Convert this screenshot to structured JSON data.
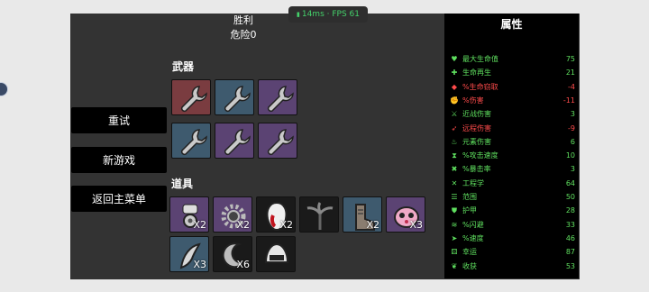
{
  "fps": {
    "text": "14ms · FPS 61"
  },
  "header": {
    "title": "胜利",
    "danger": "危险0"
  },
  "sections": {
    "weapons": "武器",
    "items": "道具"
  },
  "menu": {
    "retry": "重试",
    "new_game": "新游戏",
    "main_menu": "返回主菜单"
  },
  "weapons": [
    {
      "icon": "wrench-icon",
      "tier": "red"
    },
    {
      "icon": "wrench-icon",
      "tier": "blue"
    },
    {
      "icon": "wrench-icon",
      "tier": "purple"
    },
    {
      "icon": "wrench-icon",
      "tier": "blue"
    },
    {
      "icon": "wrench-icon",
      "tier": "purple"
    },
    {
      "icon": "wrench-icon",
      "tier": "purple"
    }
  ],
  "items": [
    {
      "icon": "robot-claw-icon",
      "tier": "purple",
      "qty": "X2"
    },
    {
      "icon": "gear-icon",
      "tier": "purple",
      "qty": "X2"
    },
    {
      "icon": "bloody-tooth-icon",
      "tier": "black",
      "qty": "X2"
    },
    {
      "icon": "tree-icon",
      "tier": "black",
      "qty": ""
    },
    {
      "icon": "boot-icon",
      "tier": "blue",
      "qty": "X2"
    },
    {
      "icon": "pink-blob-icon",
      "tier": "purple",
      "qty": "X3"
    },
    {
      "icon": "horn-icon",
      "tier": "blue",
      "qty": "X3"
    },
    {
      "icon": "moon-icon",
      "tier": "black",
      "qty": "X6"
    },
    {
      "icon": "helmet-icon",
      "tier": "black",
      "qty": ""
    }
  ],
  "stats": {
    "title": "属性",
    "rows": [
      {
        "icon": "heart-icon",
        "label": "最大生命值",
        "value": "75",
        "color": "#5fe05f",
        "glyph": "♥"
      },
      {
        "icon": "regen-icon",
        "label": "生命再生",
        "value": "21",
        "color": "#5fe05f",
        "glyph": "✚"
      },
      {
        "icon": "steal-icon",
        "label": "%生命窃取",
        "value": "-4",
        "color": "#ff4b4b",
        "glyph": "◆"
      },
      {
        "icon": "damage-icon",
        "label": "%伤害",
        "value": "-11",
        "color": "#ff4b4b",
        "glyph": "✊"
      },
      {
        "icon": "melee-icon",
        "label": "近战伤害",
        "value": "3",
        "color": "#5fe05f",
        "glyph": "⚔"
      },
      {
        "icon": "ranged-icon",
        "label": "远程伤害",
        "value": "-9",
        "color": "#ff4b4b",
        "glyph": "➶"
      },
      {
        "icon": "elemental-icon",
        "label": "元素伤害",
        "value": "6",
        "color": "#5fe05f",
        "glyph": "♨"
      },
      {
        "icon": "attack-speed-icon",
        "label": "%攻击速度",
        "value": "10",
        "color": "#5fe05f",
        "glyph": "⧗"
      },
      {
        "icon": "crit-icon",
        "label": "%暴击率",
        "value": "3",
        "color": "#5fe05f",
        "glyph": "✖"
      },
      {
        "icon": "engineering-icon",
        "label": "工程学",
        "value": "64",
        "color": "#5fe05f",
        "glyph": "✕"
      },
      {
        "icon": "range-icon",
        "label": "范围",
        "value": "50",
        "color": "#5fe05f",
        "glyph": "☰"
      },
      {
        "icon": "armor-icon",
        "label": "护甲",
        "value": "28",
        "color": "#5fe05f",
        "glyph": "⛊"
      },
      {
        "icon": "dodge-icon",
        "label": "%闪避",
        "value": "33",
        "color": "#5fe05f",
        "glyph": "≋"
      },
      {
        "icon": "speed-icon",
        "label": "%速度",
        "value": "46",
        "color": "#5fe05f",
        "glyph": "➤"
      },
      {
        "icon": "luck-icon",
        "label": "幸运",
        "value": "87",
        "color": "#5fe05f",
        "glyph": "⚄"
      },
      {
        "icon": "harvest-icon",
        "label": "收获",
        "value": "53",
        "color": "#5fe05f",
        "glyph": "❦"
      }
    ]
  },
  "colors": {
    "panel_bg": "#333333",
    "stats_bg": "#000000",
    "positive": "#5fe05f",
    "negative": "#ff4b4b",
    "fps": "#44d16a"
  }
}
